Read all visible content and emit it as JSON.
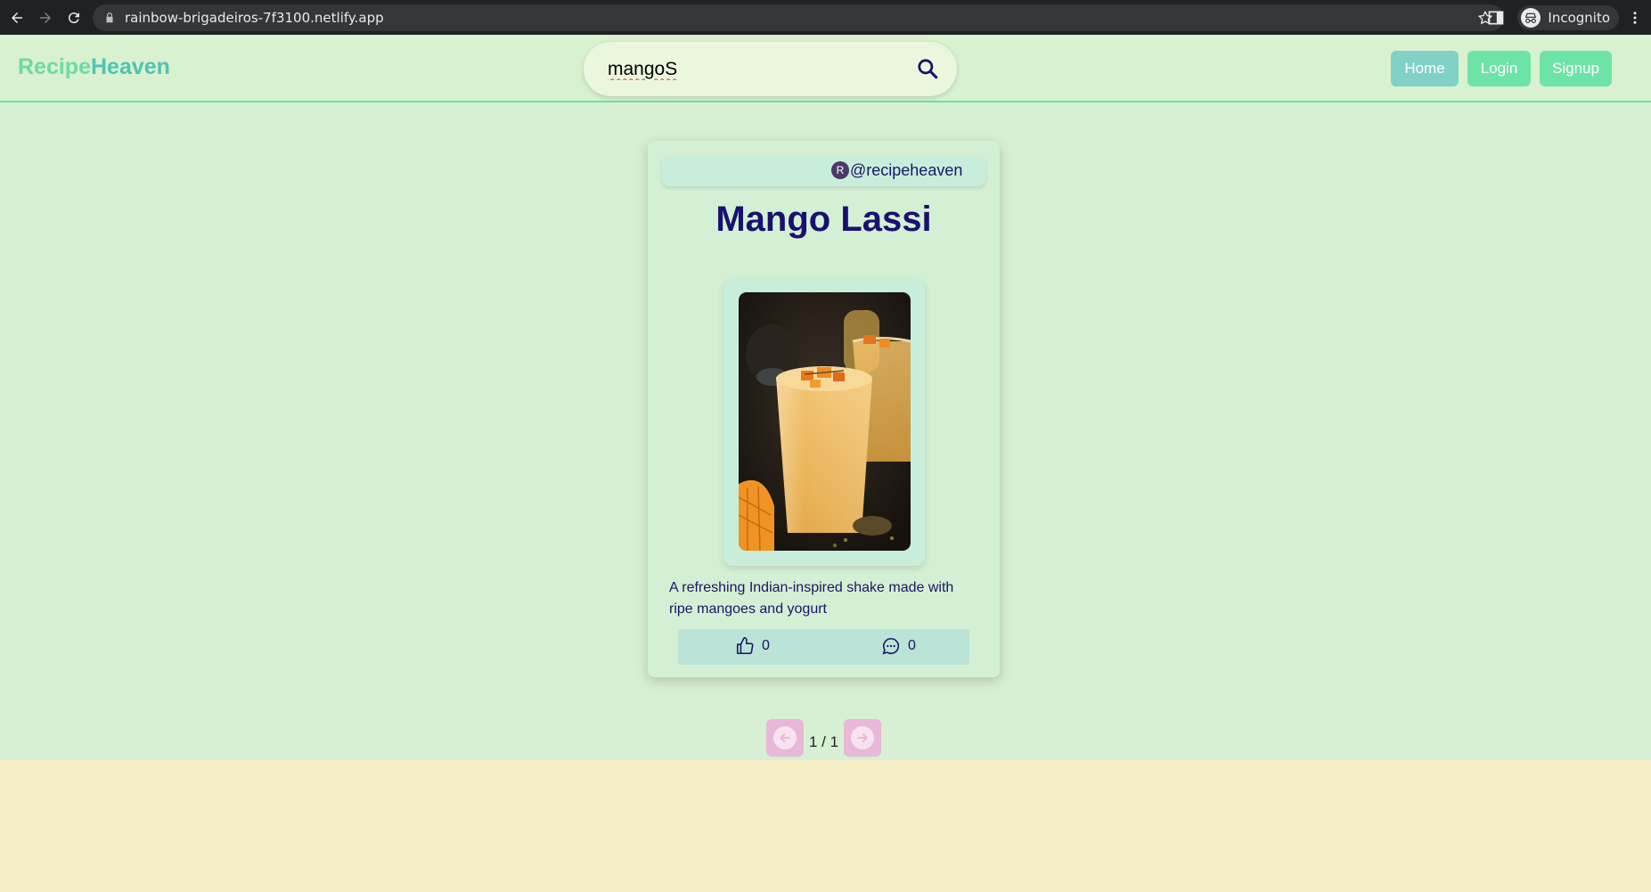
{
  "browser": {
    "url": "rainbow-brigadeiros-7f3100.netlify.app",
    "profile_label": "Incognito"
  },
  "navbar": {
    "brand_part1": "Recipe",
    "brand_part2": "Heaven",
    "search_value": "mangoS",
    "buttons": {
      "home": "Home",
      "login": "Login",
      "signup": "Signup"
    }
  },
  "card": {
    "avatar_letter": "R",
    "author_handle": "@recipeheaven",
    "title": "Mango Lassi",
    "description": "A refreshing Indian-inspired shake made with ripe mangoes and yogurt",
    "likes": "0",
    "comments": "0"
  },
  "pagination": {
    "label": "1 / 1"
  },
  "colors": {
    "brand_green": "#6ddba3",
    "brand_teal": "#4fc3b6",
    "title_navy": "#1a1070",
    "page_bg": "#d7efd2",
    "footer_bg": "#f4ecc4",
    "pager_pink": "#e9b8d8"
  },
  "icons": {
    "search": "search-icon",
    "like": "thumbs-up-icon",
    "comment": "comment-icon",
    "prev": "arrow-left-icon",
    "next": "arrow-right-icon"
  }
}
